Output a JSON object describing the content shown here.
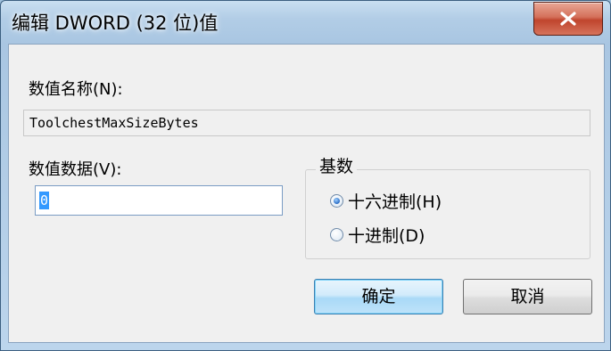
{
  "window": {
    "title": "编辑 DWORD (32 位)值"
  },
  "value_name": {
    "label": "数值名称(N):",
    "value": "ToolchestMaxSizeBytes"
  },
  "value_data": {
    "label": "数值数据(V):",
    "value": "0"
  },
  "base": {
    "title": "基数",
    "options": [
      {
        "label": "十六进制(H)",
        "checked": true
      },
      {
        "label": "十进制(D)",
        "checked": false
      }
    ]
  },
  "buttons": {
    "ok": "确定",
    "cancel": "取消"
  },
  "colors": {
    "close_button": "#c0452d",
    "selection": "#3399ff",
    "default_button_border": "#3c7fb1"
  },
  "icons": {
    "close": "close-icon"
  }
}
